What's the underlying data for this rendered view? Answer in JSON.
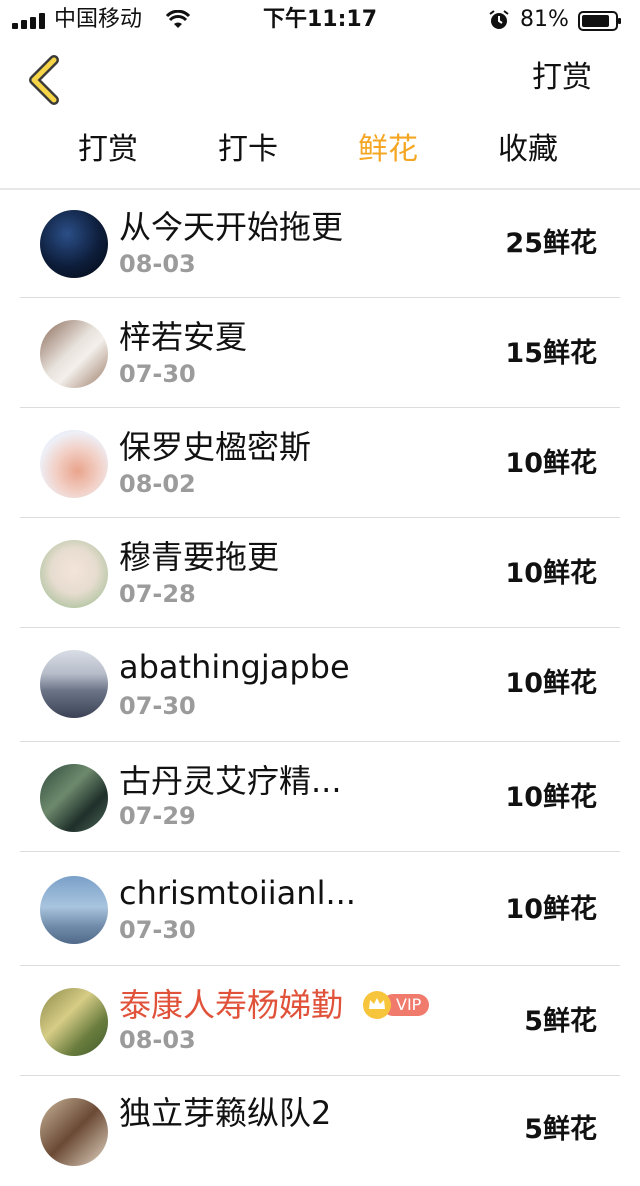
{
  "status": {
    "carrier": "中国移动",
    "time": "下午11:17",
    "battery": "81%"
  },
  "nav": {
    "action": "打赏"
  },
  "tabs": [
    {
      "label": "打赏",
      "active": false
    },
    {
      "label": "打卡",
      "active": false
    },
    {
      "label": "鲜花",
      "active": true
    },
    {
      "label": "收藏",
      "active": false
    }
  ],
  "records": [
    {
      "name": "从今天开始拖更",
      "date": "08-03",
      "amount": "25鲜花",
      "vip": false
    },
    {
      "name": "梓若安夏",
      "date": "07-30",
      "amount": "15鲜花",
      "vip": false
    },
    {
      "name": "保罗史楹密斯",
      "date": "08-02",
      "amount": "10鲜花",
      "vip": false
    },
    {
      "name": "穆青要拖更",
      "date": "07-28",
      "amount": "10鲜花",
      "vip": false
    },
    {
      "name": "abathingjapbe",
      "date": "07-30",
      "amount": "10鲜花",
      "vip": false
    },
    {
      "name": "古丹灵艾疗精...",
      "date": "07-29",
      "amount": "10鲜花",
      "vip": false
    },
    {
      "name": "chrismtoiianl...",
      "date": "07-30",
      "amount": "10鲜花",
      "vip": false
    },
    {
      "name": "泰康人寿杨娣勤",
      "date": "08-03",
      "amount": "5鲜花",
      "vip": true,
      "vip_label": "VIP"
    },
    {
      "name": "独立芽籁纵队2",
      "date": "",
      "amount": "5鲜花",
      "vip": false
    }
  ],
  "colors": {
    "accent": "#f5a623",
    "highlight_name": "#e0533a",
    "vip_tag": "#f07a6c"
  }
}
